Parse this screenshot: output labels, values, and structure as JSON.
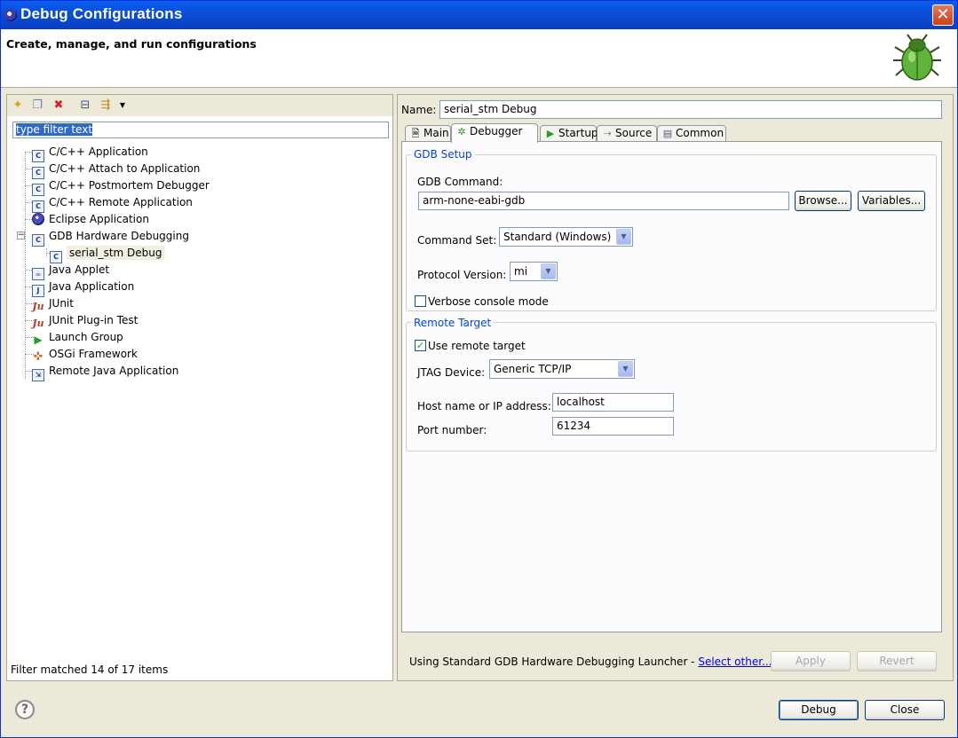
{
  "window": {
    "title": "Debug Configurations",
    "subtitle": "Create, manage, and run configurations"
  },
  "left": {
    "filter_placeholder": "type filter text",
    "tree": [
      {
        "label": "C/C++ Application",
        "icon": "c-file-icon"
      },
      {
        "label": "C/C++ Attach to Application",
        "icon": "c-file-icon"
      },
      {
        "label": "C/C++ Postmortem Debugger",
        "icon": "c-file-icon"
      },
      {
        "label": "C/C++ Remote Application",
        "icon": "c-file-icon"
      },
      {
        "label": "Eclipse Application",
        "icon": "eclipse-icon"
      },
      {
        "label": "GDB Hardware Debugging",
        "icon": "c-file-icon",
        "expanded": true
      },
      {
        "label": "serial_stm Debug",
        "icon": "c-file-icon",
        "child": true,
        "selected": true
      },
      {
        "label": "Java Applet",
        "icon": "java-applet-icon"
      },
      {
        "label": "Java Application",
        "icon": "java-app-icon"
      },
      {
        "label": "JUnit",
        "icon": "junit-icon"
      },
      {
        "label": "JUnit Plug-in Test",
        "icon": "junit-plugin-icon"
      },
      {
        "label": "Launch Group",
        "icon": "launch-group-icon"
      },
      {
        "label": "OSGi Framework",
        "icon": "osgi-icon"
      },
      {
        "label": "Remote Java Application",
        "icon": "remote-java-icon"
      }
    ],
    "filter_status": "Filter matched 14 of 17 items"
  },
  "right": {
    "name_label": "Name:",
    "name_value": "serial_stm Debug",
    "tabs": [
      "Main",
      "Debugger",
      "Startup",
      "Source",
      "Common"
    ],
    "active_tab": "Debugger",
    "gdb_setup": {
      "title": "GDB Setup",
      "command_label": "GDB Command:",
      "command_value": "arm-none-eabi-gdb",
      "browse_label": "Browse...",
      "variables_label": "Variables...",
      "command_set_label": "Command Set:",
      "command_set_value": "Standard (Windows)",
      "protocol_label": "Protocol Version:",
      "protocol_value": "mi",
      "verbose_label": "Verbose console mode",
      "verbose_checked": false
    },
    "remote_target": {
      "title": "Remote Target",
      "use_remote_label": "Use remote target",
      "use_remote_checked": true,
      "jtag_label": "JTAG Device:",
      "jtag_value": "Generic TCP/IP",
      "host_label": "Host name or IP address:",
      "host_value": "localhost",
      "port_label": "Port number:",
      "port_value": "61234"
    },
    "launcher_text": "Using Standard GDB Hardware Debugging Launcher - ",
    "select_other_link": "Select other...",
    "apply_label": "Apply",
    "revert_label": "Revert"
  },
  "footer": {
    "debug_label": "Debug",
    "close_label": "Close"
  },
  "colors": {
    "titlebar": "#0b4fd8",
    "group_title": "#0046d5",
    "selection": "#316ac5"
  }
}
